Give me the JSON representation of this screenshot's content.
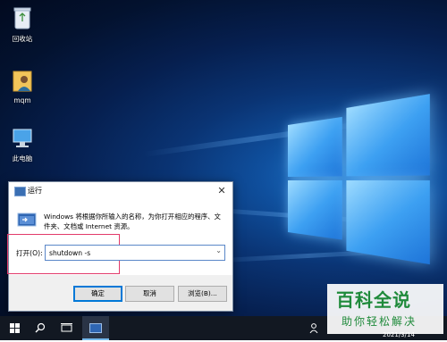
{
  "desktop": {
    "icons": [
      {
        "label": "回收站",
        "icon": "recycle-bin-icon"
      },
      {
        "label": "mqm",
        "icon": "user-folder-icon"
      },
      {
        "label": "此电脑",
        "icon": "computer-icon"
      }
    ]
  },
  "run_dialog": {
    "title": "运行",
    "close_glyph": "✕",
    "description": "Windows 将根据你所输入的名称，为你打开相应的程序、文件夹、文档或 Internet 资源。",
    "open_label": "打开(O):",
    "command_value": "shutdown -s",
    "buttons": {
      "ok": "确定",
      "cancel": "取消",
      "browse": "浏览(B)..."
    },
    "highlight_color": "#e23a6a"
  },
  "taskbar": {
    "icons": [
      "windows-start-icon",
      "search-icon",
      "task-view-icon",
      "run-app-icon"
    ],
    "clock_date": "2021/3/14",
    "tray_icon": "people-icon"
  },
  "watermark": {
    "title": "百科全说",
    "subtitle": "助你轻松解决",
    "color": "#1f8a3b"
  }
}
